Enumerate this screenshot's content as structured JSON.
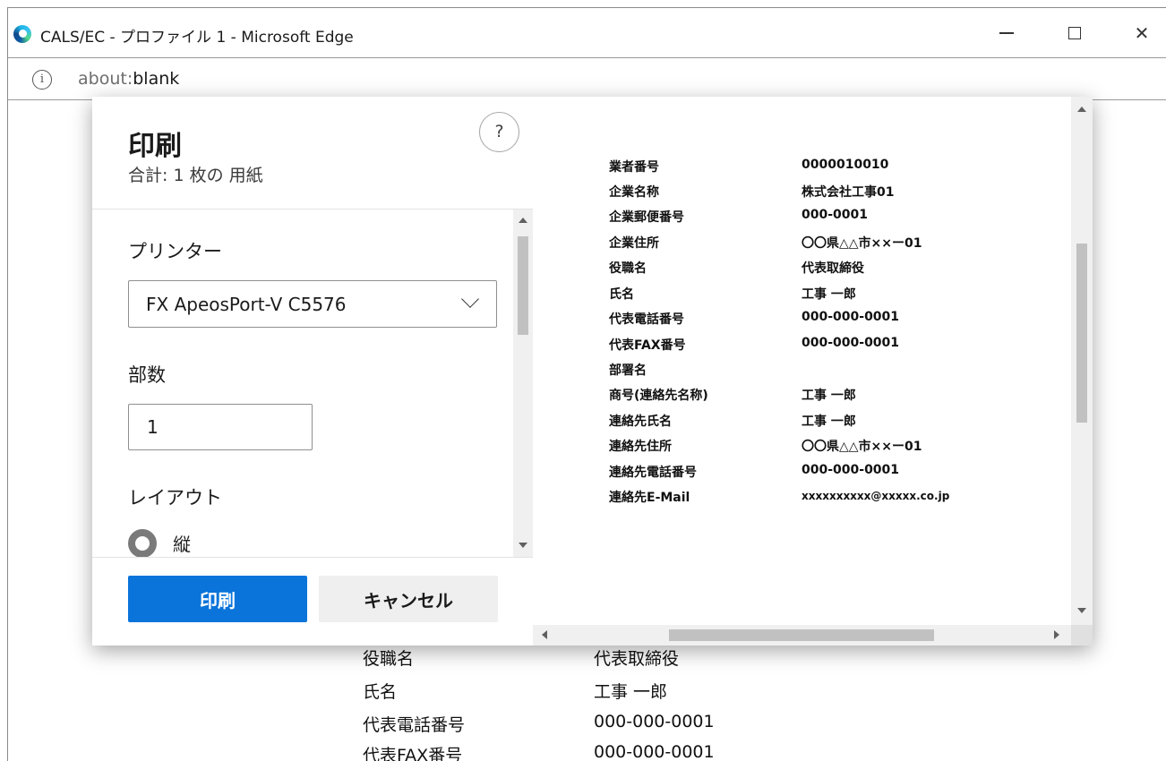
{
  "window": {
    "title": "CALS/EC - プロファイル 1 - Microsoft Edge",
    "minimize_label": "—",
    "maximize_label": "☐",
    "close_label": "✕"
  },
  "address": {
    "scheme": "about:",
    "path": "blank",
    "info_icon": "ⓘ"
  },
  "print_dialog": {
    "title": "印刷",
    "sheet_count": "合計: 1 枚の 用紙",
    "help_label": "?",
    "printer_label": "プリンター",
    "printer_value": "FX ApeosPort-V C5576",
    "copies_label": "部数",
    "copies_value": "1",
    "layout_label": "レイアウト",
    "layout_portrait": "縦",
    "print_button": "印刷",
    "cancel_button": "キャンセル"
  },
  "preview": {
    "rows": [
      {
        "label": "業者番号",
        "value": "0000010010"
      },
      {
        "label": "企業名称",
        "value": "株式会社工事01"
      },
      {
        "label": "企業郵便番号",
        "value": "000-0001"
      },
      {
        "label": "企業住所",
        "value": "〇〇県△△市××ー01"
      },
      {
        "label": "役職名",
        "value": "代表取締役"
      },
      {
        "label": "氏名",
        "value": "工事 一郎"
      },
      {
        "label": "代表電話番号",
        "value": "000-000-0001"
      },
      {
        "label": "代表FAX番号",
        "value": "000-000-0001"
      },
      {
        "label": "部署名",
        "value": ""
      },
      {
        "label": "商号(連絡先名称)",
        "value": "工事 一郎"
      },
      {
        "label": "連絡先氏名",
        "value": "工事 一郎"
      },
      {
        "label": "連絡先住所",
        "value": "〇〇県△△市××ー01"
      },
      {
        "label": "連絡先電話番号",
        "value": "000-000-0001"
      },
      {
        "label": "連絡先E-Mail",
        "value": "xxxxxxxxxx@xxxxx.co.jp"
      }
    ]
  },
  "background_page": {
    "rows": [
      {
        "label": "役職名",
        "value": "代表取締役"
      },
      {
        "label": "氏名",
        "value": "工事 一郎"
      },
      {
        "label": "代表電話番号",
        "value": "000-000-0001"
      },
      {
        "label": "代表FAX番号",
        "value": "000-000-0001"
      }
    ]
  },
  "colors": {
    "accent": "#0a74da",
    "cancel_bg": "#efefef",
    "preview_bg": "#e8e8e8"
  }
}
